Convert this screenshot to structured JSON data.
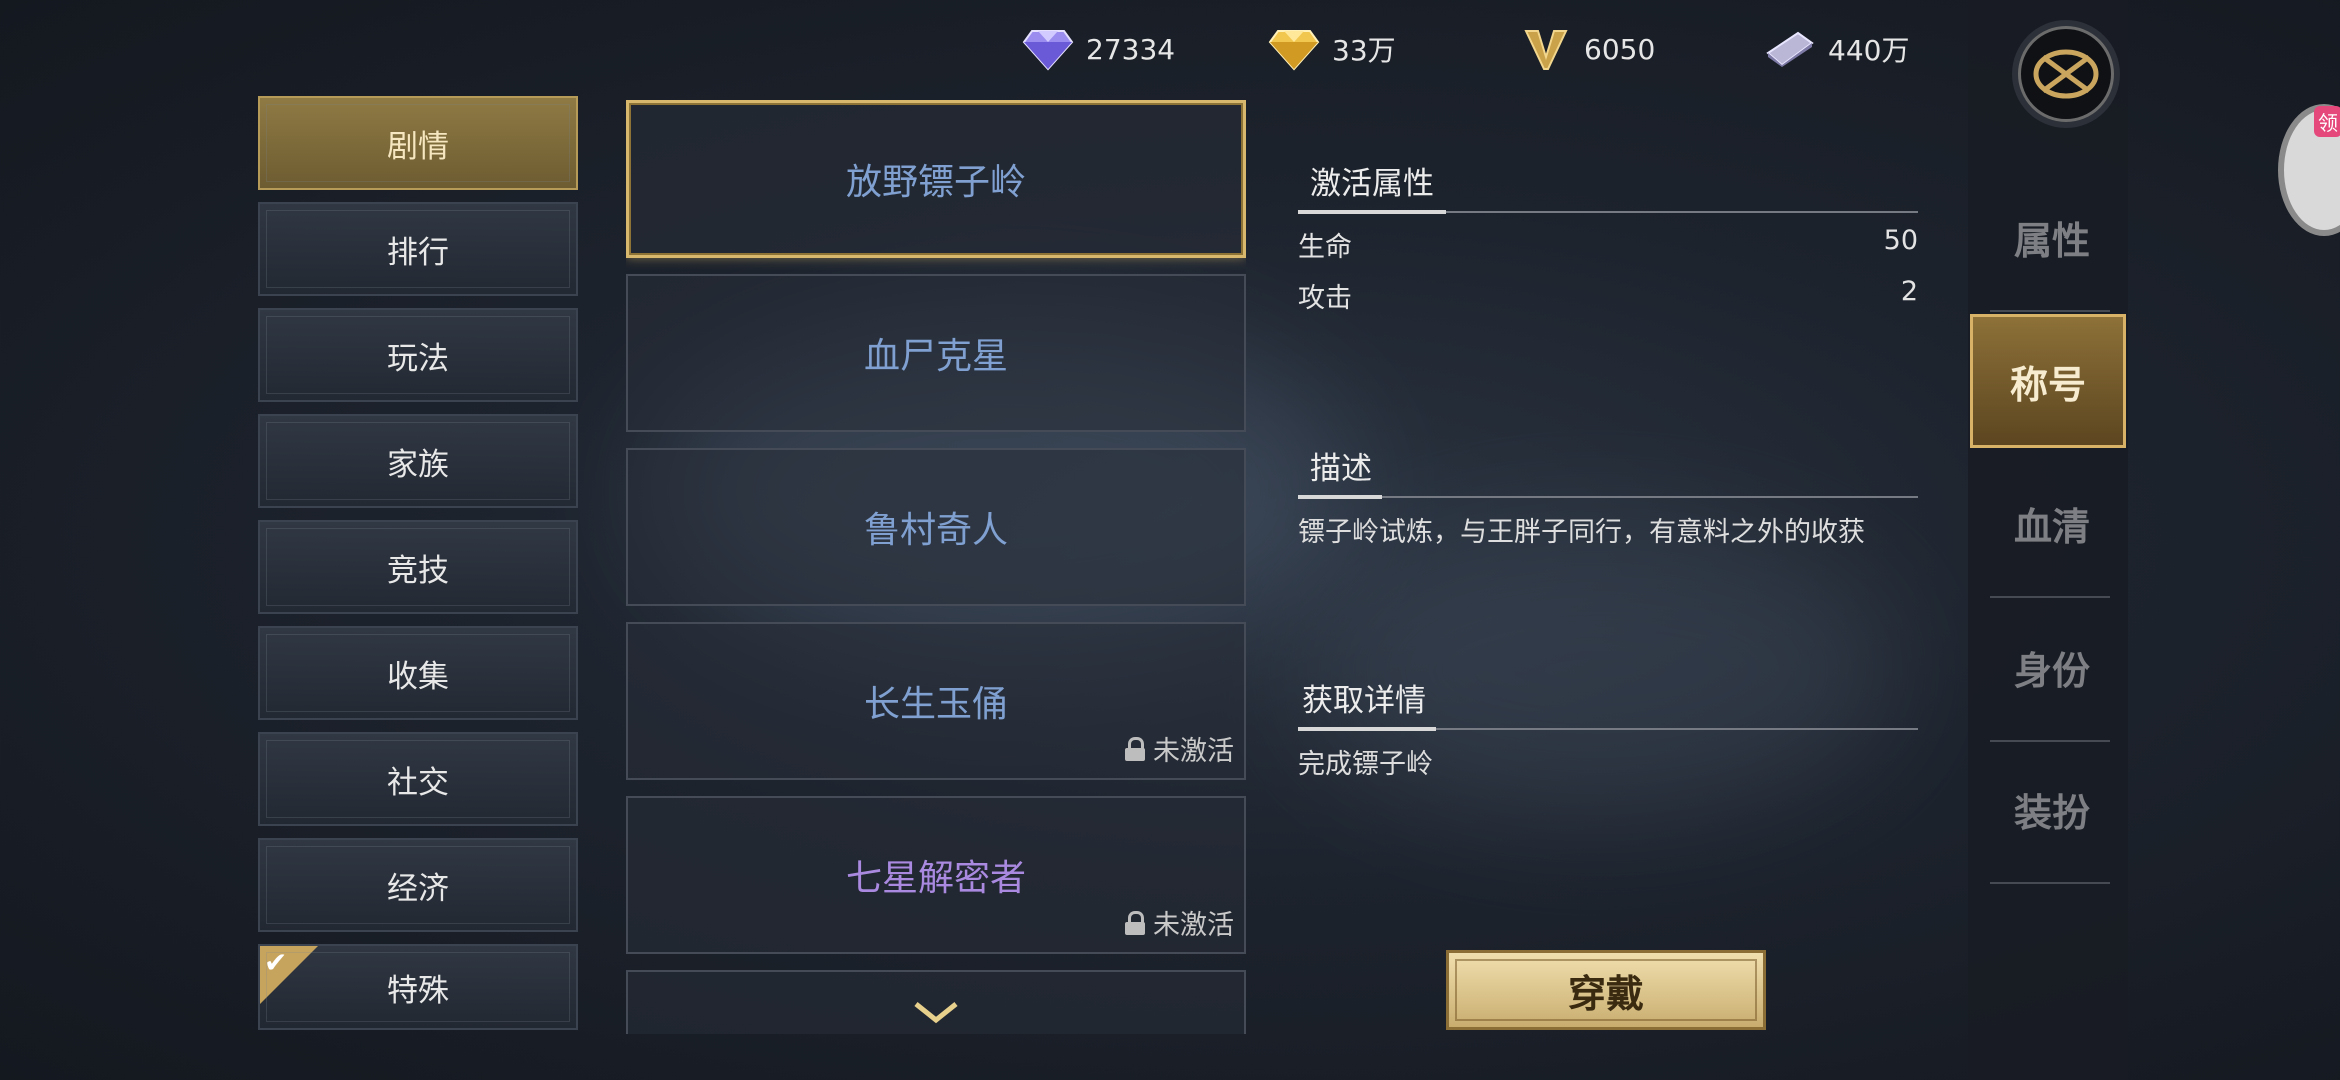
{
  "currencies": [
    {
      "icon": "purple-diamond-icon",
      "value": "27334"
    },
    {
      "icon": "gold-diamond-icon",
      "value": "33万"
    },
    {
      "icon": "v-points-icon",
      "value": "6050"
    },
    {
      "icon": "silver-ticket-icon",
      "value": "440万"
    }
  ],
  "categories": [
    {
      "label": "剧情",
      "active": true
    },
    {
      "label": "排行"
    },
    {
      "label": "玩法"
    },
    {
      "label": "家族"
    },
    {
      "label": "竞技"
    },
    {
      "label": "收集"
    },
    {
      "label": "社交"
    },
    {
      "label": "经济"
    },
    {
      "label": "特殊",
      "checked": true
    }
  ],
  "titles": [
    {
      "name": "放野镖子岭",
      "selected": true
    },
    {
      "name": "血尸克星"
    },
    {
      "name": "鲁村奇人"
    },
    {
      "name": "长生玉俑",
      "status": "未激活"
    },
    {
      "name": "七星解密者",
      "status": "未激活",
      "color": "purple"
    }
  ],
  "detail": {
    "attr_heading": "激活属性",
    "attributes": [
      {
        "name": "生命",
        "value": "50"
      },
      {
        "name": "攻击",
        "value": "2"
      }
    ],
    "desc_heading": "描述",
    "description": "镖子岭试炼，与王胖子同行，有意料之外的收获",
    "acquire_heading": "获取详情",
    "acquire_text": "完成镖子岭"
  },
  "wear_button": "穿戴",
  "right_tabs": [
    {
      "label": "属性"
    },
    {
      "label": "称号",
      "active": true
    },
    {
      "label": "血清"
    },
    {
      "label": "身份"
    },
    {
      "label": "装扮"
    }
  ],
  "side_badge_tag": "领"
}
